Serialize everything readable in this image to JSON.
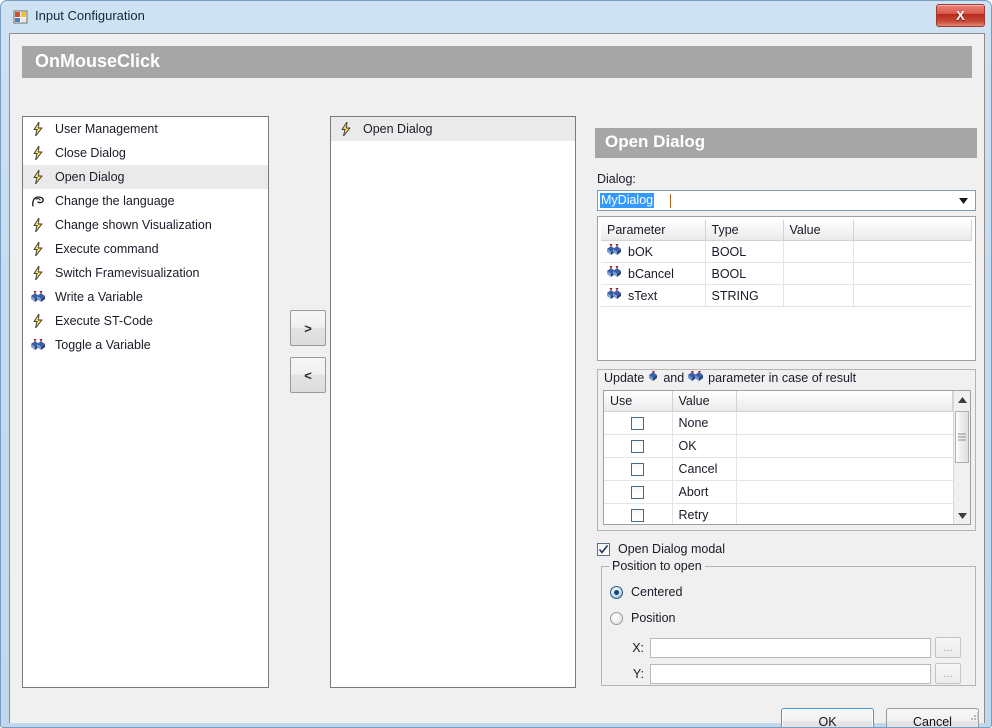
{
  "window": {
    "title": "Input Configuration",
    "icon": "form-icon",
    "close_label": "X"
  },
  "banner": {
    "title": "OnMouseClick"
  },
  "available_list": {
    "items": [
      {
        "label": "User Management",
        "icon": "lightning-icon",
        "selected": false
      },
      {
        "label": "Close Dialog",
        "icon": "lightning-icon",
        "selected": false
      },
      {
        "label": "Open Dialog",
        "icon": "lightning-icon",
        "selected": true
      },
      {
        "label": "Change the language",
        "icon": "language-icon",
        "selected": false
      },
      {
        "label": "Change shown Visualization",
        "icon": "lightning-icon",
        "selected": false
      },
      {
        "label": "Execute command",
        "icon": "lightning-icon",
        "selected": false
      },
      {
        "label": "Switch Framevisualization",
        "icon": "lightning-icon",
        "selected": false
      },
      {
        "label": "Write a Variable",
        "icon": "variable-icon",
        "selected": false
      },
      {
        "label": "Execute ST-Code",
        "icon": "lightning-icon",
        "selected": false
      },
      {
        "label": "Toggle a Variable",
        "icon": "variable-icon",
        "selected": false
      }
    ]
  },
  "assigned_list": {
    "items": [
      {
        "label": "Open Dialog",
        "icon": "lightning-icon",
        "selected": true
      }
    ]
  },
  "transfer": {
    "add_label": ">",
    "remove_label": "<"
  },
  "detail": {
    "title": "Open Dialog",
    "dialog_label": "Dialog:",
    "dialog_value": "MyDialog",
    "parameter_table": {
      "columns": [
        "Parameter",
        "Type",
        "Value",
        ""
      ],
      "rows": [
        {
          "parameter": "bOK",
          "type": "BOOL",
          "value": "",
          "icon": "inout-variable-icon"
        },
        {
          "parameter": "bCancel",
          "type": "BOOL",
          "value": "",
          "icon": "inout-variable-icon"
        },
        {
          "parameter": "sText",
          "type": "STRING",
          "value": "",
          "icon": "inout-variable-icon"
        }
      ]
    },
    "result_group": {
      "title_part1": "Update",
      "title_part2": "and",
      "title_part3": "parameter in case of result",
      "columns": [
        "Use",
        "Value",
        ""
      ],
      "rows": [
        {
          "use": false,
          "value": "None"
        },
        {
          "use": false,
          "value": "OK"
        },
        {
          "use": false,
          "value": "Cancel"
        },
        {
          "use": false,
          "value": "Abort"
        },
        {
          "use": false,
          "value": "Retry"
        }
      ]
    },
    "modal_checkbox": {
      "label": "Open Dialog modal",
      "checked": true
    },
    "position_group": {
      "title": "Position to open",
      "options": [
        {
          "label": "Centered",
          "selected": true
        },
        {
          "label": "Position",
          "selected": false
        }
      ],
      "x_label": "X:",
      "x_value": "",
      "y_label": "Y:",
      "y_value": "",
      "browse_label": "..."
    }
  },
  "footer": {
    "ok_label": "OK",
    "cancel_label": "Cancel"
  }
}
